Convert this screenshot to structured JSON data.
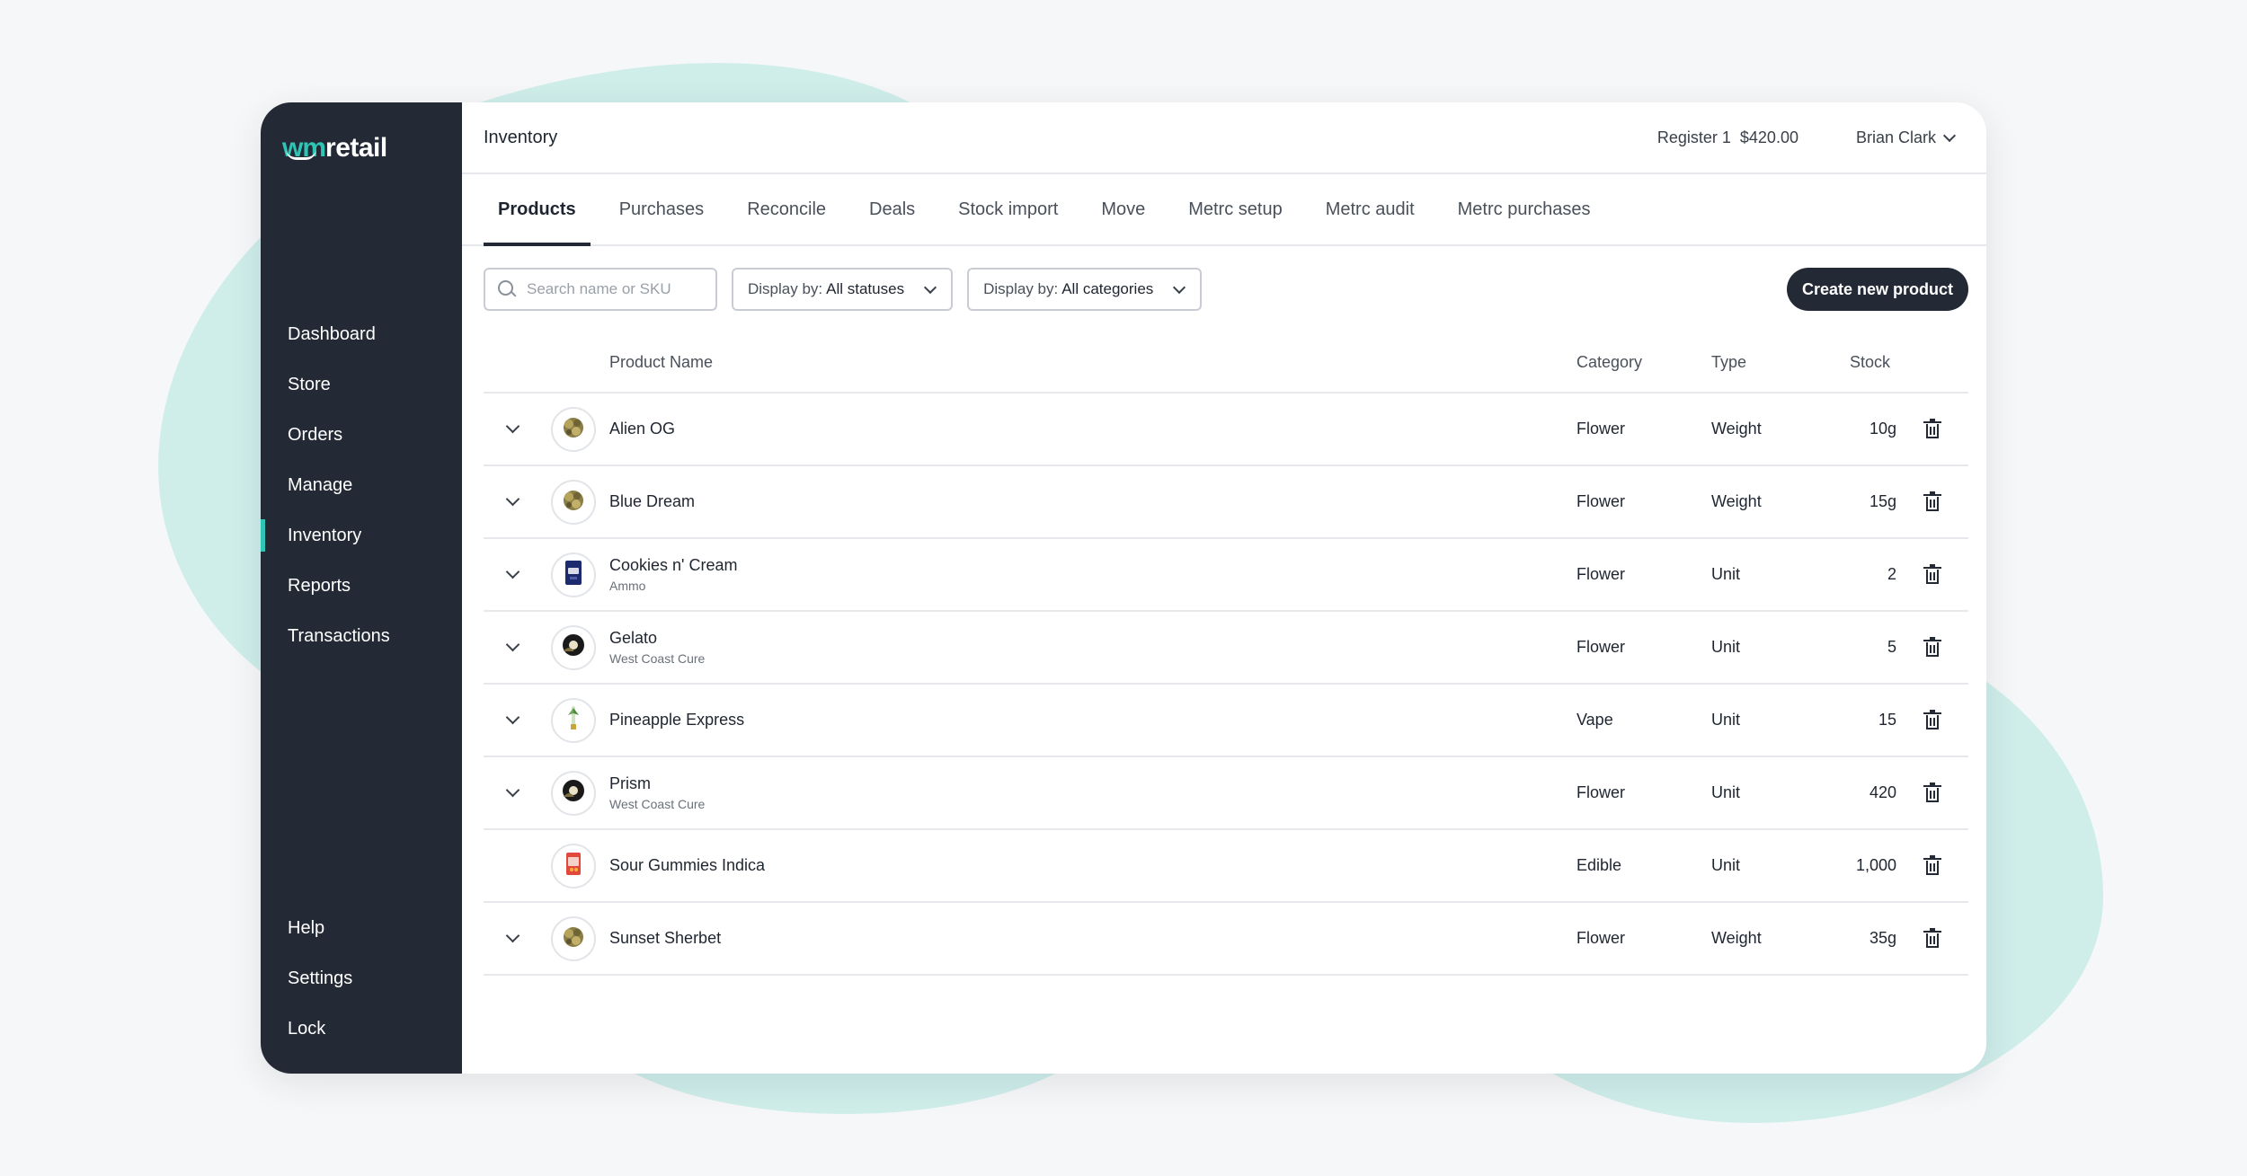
{
  "app": {
    "logo_prefix": "wm",
    "logo_suffix": "retail",
    "accent_color": "#2ec4b6",
    "sidebar_color": "#242a35"
  },
  "sidebar": {
    "items": [
      {
        "label": "Dashboard"
      },
      {
        "label": "Store"
      },
      {
        "label": "Orders"
      },
      {
        "label": "Manage"
      },
      {
        "label": "Inventory",
        "active": true
      },
      {
        "label": "Reports"
      },
      {
        "label": "Transactions"
      }
    ],
    "bottom_items": [
      {
        "label": "Help"
      },
      {
        "label": "Settings"
      },
      {
        "label": "Lock"
      }
    ]
  },
  "header": {
    "title": "Inventory",
    "register": "Register 1  $420.00",
    "user_name": "Brian Clark"
  },
  "tabs": [
    {
      "label": "Products",
      "active": true
    },
    {
      "label": "Purchases"
    },
    {
      "label": "Reconcile"
    },
    {
      "label": "Deals"
    },
    {
      "label": "Stock import"
    },
    {
      "label": "Move"
    },
    {
      "label": "Metrc setup"
    },
    {
      "label": "Metrc audit"
    },
    {
      "label": "Metrc purchases"
    }
  ],
  "toolbar": {
    "search_placeholder": "Search name or SKU",
    "status_filter_prefix": "Display by:",
    "status_filter_value": "All statuses",
    "category_filter_prefix": "Display by:",
    "category_filter_value": "All categories",
    "create_label": "Create new product"
  },
  "table": {
    "headers": {
      "name": "Product Name",
      "category": "Category",
      "type": "Type",
      "stock": "Stock"
    },
    "rows": [
      {
        "name": "Alien OG",
        "brand": "",
        "category": "Flower",
        "type": "Weight",
        "stock": "10g",
        "expandable": true,
        "thumb_icon": "flower-bud-icon"
      },
      {
        "name": "Blue Dream",
        "brand": "",
        "category": "Flower",
        "type": "Weight",
        "stock": "15g",
        "expandable": true,
        "thumb_icon": "flower-bud-icon"
      },
      {
        "name": "Cookies n' Cream",
        "brand": "Ammo",
        "category": "Flower",
        "type": "Unit",
        "stock": "2",
        "expandable": true,
        "thumb_icon": "package-bag-icon"
      },
      {
        "name": "Gelato",
        "brand": "West Coast Cure",
        "category": "Flower",
        "type": "Unit",
        "stock": "5",
        "expandable": true,
        "thumb_icon": "jar-icon"
      },
      {
        "name": "Pineapple Express",
        "brand": "",
        "category": "Vape",
        "type": "Unit",
        "stock": "15",
        "expandable": true,
        "thumb_icon": "vape-cartridge-icon"
      },
      {
        "name": "Prism",
        "brand": "West Coast Cure",
        "category": "Flower",
        "type": "Unit",
        "stock": "420",
        "expandable": true,
        "thumb_icon": "jar-icon"
      },
      {
        "name": "Sour Gummies Indica",
        "brand": "",
        "category": "Edible",
        "type": "Unit",
        "stock": "1,000",
        "expandable": false,
        "thumb_icon": "gummies-pack-icon"
      },
      {
        "name": "Sunset Sherbet",
        "brand": "",
        "category": "Flower",
        "type": "Weight",
        "stock": "35g",
        "expandable": true,
        "thumb_icon": "flower-bud-icon"
      }
    ]
  }
}
